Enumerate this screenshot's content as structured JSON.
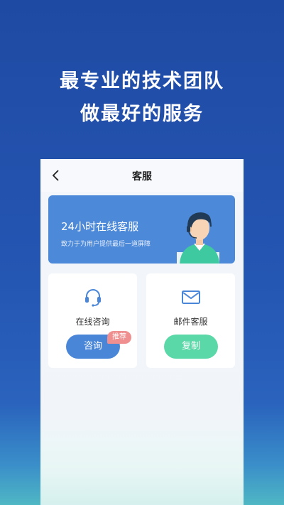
{
  "promo": {
    "headline_line1": "最专业的技术团队",
    "headline_line2": "做最好的服务"
  },
  "nav": {
    "title": "客服",
    "back_icon": "chevron-left-icon"
  },
  "banner": {
    "title": "24小时在线客服",
    "subtitle": "致力于为用户提供最后一道屏障",
    "illustration": "customer-service-agent"
  },
  "cards": {
    "online": {
      "icon": "headset-icon",
      "label": "在线咨询",
      "button_label": "咨询",
      "badge": "推荐"
    },
    "email": {
      "icon": "mail-icon",
      "label": "邮件客服",
      "button_label": "复制"
    }
  },
  "colors": {
    "background": "#2456b3",
    "banner": "#4c89d8",
    "primary_button": "#4a86d8",
    "copy_button": "#5bd8a8",
    "badge": "#ef8f8f"
  }
}
